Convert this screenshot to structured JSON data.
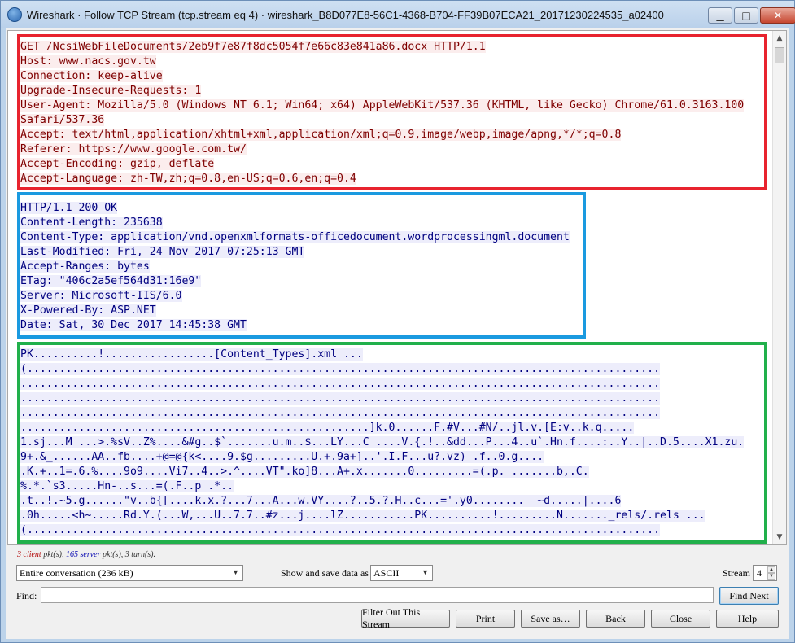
{
  "window": {
    "title": "Wireshark · Follow TCP Stream (tcp.stream eq 4) · wireshark_B8D077E8-56C1-4368-B704-FF39B07ECA21_20171230224535_a02400",
    "controls": {
      "minimize": "▁",
      "maximize": "□",
      "close": "✕"
    }
  },
  "stream": {
    "request_lines": [
      "GET /NcsiWebFileDocuments/2eb9f7e87f8dc5054f7e66c83e841a86.docx HTTP/1.1",
      "Host: www.nacs.gov.tw",
      "Connection: keep-alive",
      "Upgrade-Insecure-Requests: 1",
      "User-Agent: Mozilla/5.0 (Windows NT 6.1; Win64; x64) AppleWebKit/537.36 (KHTML, like Gecko) Chrome/61.0.3163.100",
      "Safari/537.36",
      "Accept: text/html,application/xhtml+xml,application/xml;q=0.9,image/webp,image/apng,*/*;q=0.8",
      "Referer: https://www.google.com.tw/",
      "Accept-Encoding: gzip, deflate",
      "Accept-Language: zh-TW,zh;q=0.8,en-US;q=0.6,en;q=0.4"
    ],
    "response_lines": [
      "HTTP/1.1 200 OK",
      "Content-Length: 235638",
      "Content-Type: application/vnd.openxmlformats-officedocument.wordprocessingml.document",
      "Last-Modified: Fri, 24 Nov 2017 07:25:13 GMT",
      "Accept-Ranges: bytes",
      "ETag: \"406c2a5ef564d31:16e9\"",
      "Server: Microsoft-IIS/6.0",
      "X-Powered-By: ASP.NET",
      "Date: Sat, 30 Dec 2017 14:45:38 GMT"
    ],
    "body_lines": [
      "PK..........!.................[Content_Types].xml ...",
      "(..................................................................................................",
      "...................................................................................................",
      "...................................................................................................",
      "...................................................................................................",
      "......................................................]k.0......F.#V...#N/..jl.v.[E:v..k.q.....",
      "1.sj...M ...>.%sV..Z%....&#g..$`.......u.m..$...LY...C ....V.{.!..&dd...P...4..u`.Hn.f....:..Y..|..D.5....X1.zu.",
      "9+.&_......AA..fb....+@=@{k<....9.$g.........U.+.9a+]..'.I.F...u?.vz) .f..0.g....",
      ".K.+..1=.6.%....9o9....Vi7..4..>.^....VT\".ko]8...A+.x.......0.........=(.p. .......b,.C.",
      "%.*.`s3.....Hn-..s...=(.F..p .*..",
      ".t..!.~5.g......\"v..b{[....k.x.?...7...A...w.VY....?..5.?.H..c...='.y0........  ~d.....|....6",
      ".0h.....<h~.....Rd.Y.(...W,...U..7.7..#z...j....lZ...........PK..........!.........N......._rels/.rels ...",
      "(.................................................................................................."
    ],
    "highlight_colors": {
      "request": "#e8232e",
      "response": "#1a9ae0",
      "body": "#21b04b"
    }
  },
  "status": {
    "client_count": "3",
    "client_word": "client",
    "server_count": "165",
    "server_word": "server",
    "rest": "3 turn(s)."
  },
  "controls": {
    "conversation_select": "Entire conversation (236 kB)",
    "show_save_label": "Show and save data as",
    "format_select": "ASCII",
    "stream_label": "Stream",
    "stream_value": "4",
    "find_label": "Find:",
    "find_value": "",
    "find_next": "Find Next",
    "buttons": {
      "filter_out": "Filter Out This Stream",
      "print": "Print",
      "save_as": "Save as…",
      "back": "Back",
      "close": "Close",
      "help": "Help"
    }
  }
}
